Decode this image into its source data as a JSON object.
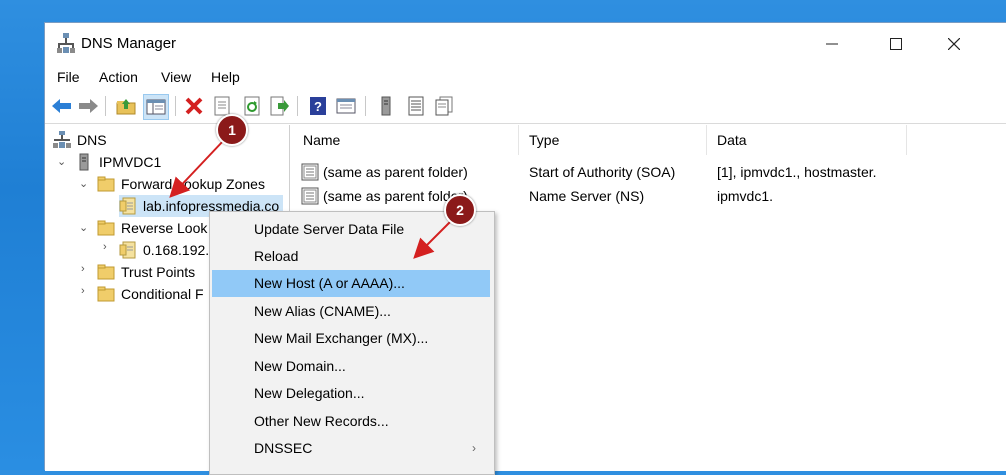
{
  "window": {
    "title": "DNS Manager"
  },
  "menu": [
    "File",
    "Action",
    "View",
    "Help"
  ],
  "toolbar_icons": [
    "back-arrow-icon",
    "forward-arrow-icon",
    "up-folder-icon",
    "show-hide-tree-icon",
    "delete-icon",
    "properties-icon",
    "refresh-icon",
    "export-icon",
    "help-icon",
    "console-icon",
    "server-icon",
    "list-icon",
    "records-icon"
  ],
  "tree": {
    "root": "DNS",
    "server": "IPMVDC1",
    "forward": "Forward Lookup Zones",
    "zone": "lab.infopressmedia.co",
    "reverse": "Reverse Look",
    "reverse_zone": "0.168.192.",
    "trust": "Trust Points",
    "conditional": "Conditional F"
  },
  "list": {
    "columns": [
      "Name",
      "Type",
      "Data"
    ],
    "rows": [
      {
        "name": "(same as parent folder)",
        "type": "Start of Authority (SOA)",
        "data": "[1], ipmvdc1., hostmaster."
      },
      {
        "name": "(same as parent folder)",
        "type": "Name Server (NS)",
        "data": "ipmvdc1."
      }
    ]
  },
  "context_menu": [
    "Update Server Data File",
    "Reload",
    "New Host (A or AAAA)...",
    "New Alias (CNAME)...",
    "New Mail Exchanger (MX)...",
    "New Domain...",
    "New Delegation...",
    "Other New Records...",
    "DNSSEC"
  ],
  "context_highlighted": "New Host (A or AAAA)...",
  "callouts": [
    "1",
    "2"
  ],
  "colors": {
    "accent": "#91c9f7",
    "callout": "#8b1a1a",
    "arrow": "#d42020",
    "desktop": "#2a8ee2"
  }
}
